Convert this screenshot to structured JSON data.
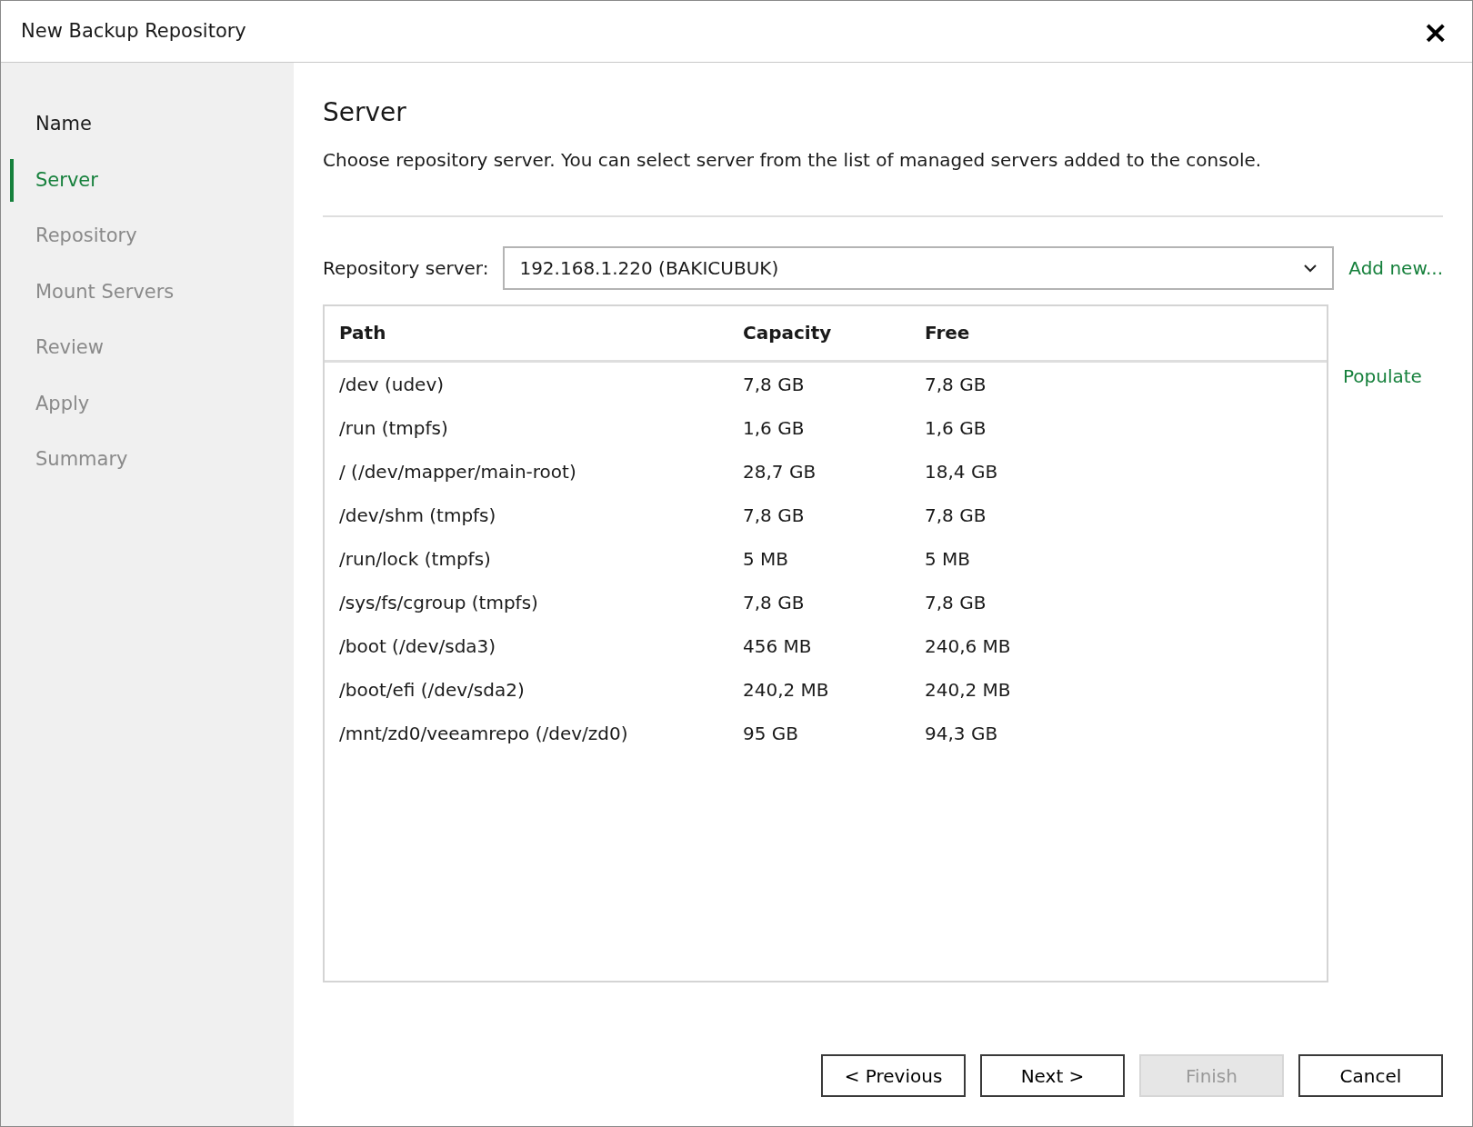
{
  "window": {
    "title": "New Backup Repository",
    "close": "×"
  },
  "steps": [
    {
      "label": "Name",
      "selected": false,
      "disabled": false
    },
    {
      "label": "Server",
      "selected": true,
      "disabled": false
    },
    {
      "label": "Repository",
      "selected": false,
      "disabled": true
    },
    {
      "label": "Mount Servers",
      "selected": false,
      "disabled": true
    },
    {
      "label": "Review",
      "selected": false,
      "disabled": true
    },
    {
      "label": "Apply",
      "selected": false,
      "disabled": true
    },
    {
      "label": "Summary",
      "selected": false,
      "disabled": true
    }
  ],
  "page": {
    "title": "Server",
    "description": "Choose repository server. You can select server from the list of managed servers added to the console."
  },
  "repository_server": {
    "label": "Repository server:",
    "value": "192.168.1.220 (BAKICUBUK)",
    "add_link": "Add new..."
  },
  "table": {
    "columns": [
      "Path",
      "Capacity",
      "Free"
    ],
    "rows": [
      [
        "/dev (udev)",
        "7,8 GB",
        "7,8 GB"
      ],
      [
        "/run (tmpfs)",
        "1,6 GB",
        "1,6 GB"
      ],
      [
        "/ (/dev/mapper/main-root)",
        "28,7 GB",
        "18,4 GB"
      ],
      [
        "/dev/shm (tmpfs)",
        "7,8 GB",
        "7,8 GB"
      ],
      [
        "/run/lock (tmpfs)",
        "5 MB",
        "5 MB"
      ],
      [
        "/sys/fs/cgroup (tmpfs)",
        "7,8 GB",
        "7,8 GB"
      ],
      [
        "/boot (/dev/sda3)",
        "456 MB",
        "240,6 MB"
      ],
      [
        "/boot/efi (/dev/sda2)",
        "240,2 MB",
        "240,2 MB"
      ],
      [
        "/mnt/zd0/veeamrepo (/dev/zd0)",
        "95 GB",
        "94,3 GB"
      ]
    ]
  },
  "populate_link": "Populate",
  "buttons": [
    {
      "label": "< Previous",
      "disabled": false
    },
    {
      "label": "Next >",
      "disabled": false
    },
    {
      "label": "Finish",
      "disabled": true
    },
    {
      "label": "Cancel",
      "disabled": false
    }
  ]
}
